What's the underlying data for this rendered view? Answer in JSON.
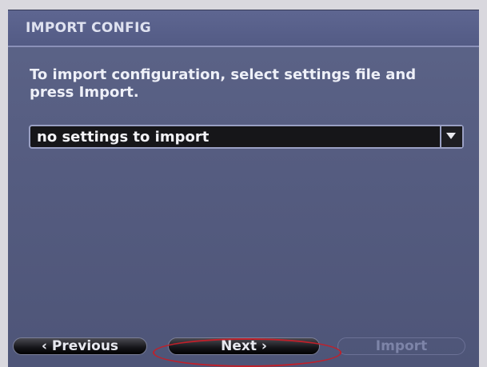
{
  "dialog": {
    "title": "IMPORT CONFIG",
    "instructions": "To import configuration, select settings file and press Import."
  },
  "settings_select": {
    "value": "no settings to import",
    "arrow_icon": "chevron-down-icon"
  },
  "buttons": {
    "previous_label": "‹ Previous",
    "next_label": "Next ›",
    "import_label": "Import"
  },
  "colors": {
    "background": "#555c80",
    "highlight_ring": "#c0202a",
    "disabled_text": "#7d84a8"
  }
}
